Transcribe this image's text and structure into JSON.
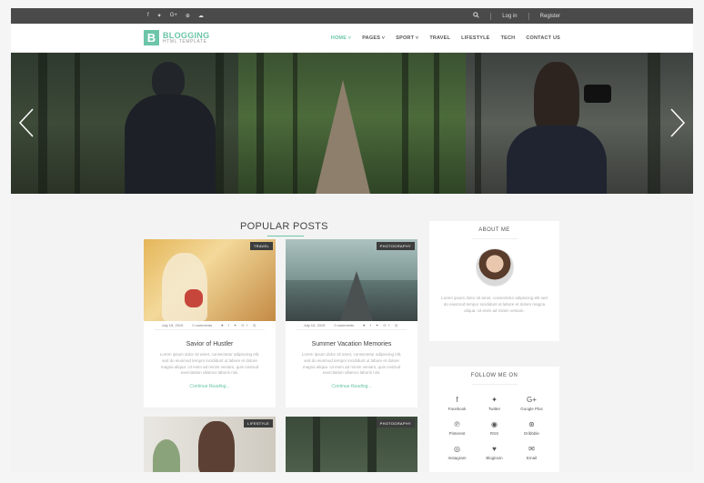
{
  "topbar": {
    "social_icons": [
      "f",
      "t",
      "G+",
      "p",
      "cloud"
    ],
    "search_icon": "search-icon",
    "login": "Log in",
    "register": "Register"
  },
  "header": {
    "logo_letter": "B",
    "logo_main": "BLOGGING",
    "logo_sub": "HTML TEMPLATE",
    "nav": [
      {
        "label": "HOME ˅",
        "active": true
      },
      {
        "label": "PAGES ˅",
        "active": false
      },
      {
        "label": "SPORT ˅",
        "active": false
      },
      {
        "label": "TRAVEL",
        "active": false
      },
      {
        "label": "LIFESTYLE",
        "active": false
      },
      {
        "label": "TECH",
        "active": false
      },
      {
        "label": "CONTACT US",
        "active": false
      }
    ]
  },
  "main": {
    "section_title": "POPULAR POSTS",
    "posts": [
      {
        "tag": "TRAVEL",
        "date": "July 15, 2015",
        "comments": "0 comments",
        "share_icons": "♥ f ✦ G+ ◎",
        "title": "Savior of Hustler",
        "excerpt": "Lorem ipsum dolor sit amet, consectetur adipiscing elit, sed do eiusmod tempor incididunt ut labore et dolore magna aliqua. Ut enim ad minim veniam, quis nostrud exercitation ullamco laboris nisi.",
        "more": "Continue Reading..."
      },
      {
        "tag": "PHOTOGRAPHY",
        "date": "July 15, 2015",
        "comments": "0 comments",
        "share_icons": "♥ f ✦ G+ ◎",
        "title": "Summer Vacation Memories",
        "excerpt": "Lorem ipsum dolor sit amet, consectetur adipiscing elit, sed do eiusmod tempor incididunt ut labore et dolore magna aliqua. Ut enim ad minim veniam, quis nostrud exercitation ullamco laboris nisi.",
        "more": "Continue Reading..."
      },
      {
        "tag": "LIFESTYLE"
      },
      {
        "tag": "PHOTOGRAPHY"
      }
    ]
  },
  "sidebar": {
    "about_title": "ABOUT ME",
    "about_text": "Lorem ipsum dolor sit amet, consectetur adipiscing elit sed do eiusmod tempor incididunt ut labore et dolore magna aliqua. Ut enim ad minim veniam.",
    "follow_title": "FOLLOW ME ON",
    "follow": [
      {
        "icon": "f",
        "label": "Facebook"
      },
      {
        "icon": "✦",
        "label": "Twitter"
      },
      {
        "icon": "G+",
        "label": "Google Plus"
      },
      {
        "icon": "℗",
        "label": "Pinterest"
      },
      {
        "icon": "◉",
        "label": "RSS"
      },
      {
        "icon": "⊛",
        "label": "Dribbble"
      },
      {
        "icon": "◎",
        "label": "Instagram"
      },
      {
        "icon": "♥",
        "label": "Bloglovin"
      },
      {
        "icon": "✉",
        "label": "Email"
      }
    ]
  }
}
